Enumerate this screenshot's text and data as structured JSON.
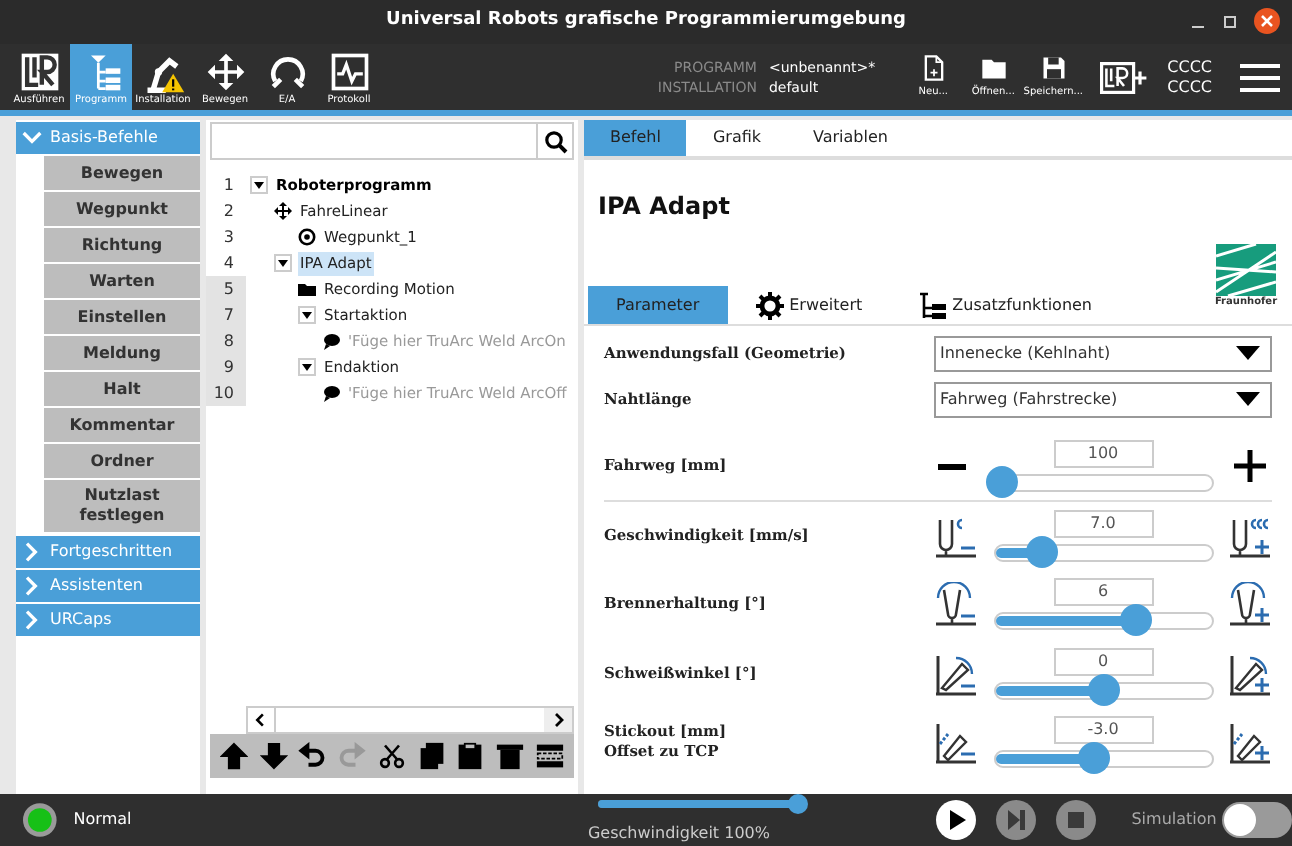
{
  "window": {
    "title": "Universal Robots grafische Programmierumgebung"
  },
  "toolbar": {
    "tabs": [
      {
        "label": "Ausführen",
        "kind": "run",
        "selected": false,
        "warning": false
      },
      {
        "label": "Programm",
        "kind": "program",
        "selected": true,
        "warning": false
      },
      {
        "label": "Installation",
        "kind": "installation",
        "selected": false,
        "warning": true
      },
      {
        "label": "Bewegen",
        "kind": "move",
        "selected": false,
        "warning": false
      },
      {
        "label": "E/A",
        "kind": "io",
        "selected": false,
        "warning": false
      },
      {
        "label": "Protokoll",
        "kind": "log",
        "selected": false,
        "warning": false
      }
    ],
    "program_label": "PROGRAMM",
    "program_value": "<unbenannt>*",
    "installation_label": "INSTALLATION",
    "installation_value": "default",
    "file_buttons": [
      {
        "kind": "new",
        "label": "Neu..."
      },
      {
        "kind": "open",
        "label": "Öffnen..."
      },
      {
        "kind": "save",
        "label": "Speichern..."
      }
    ],
    "status_lines": [
      "CCCC",
      "CCCC"
    ]
  },
  "sidebar": {
    "groups": [
      {
        "label": "Basis-Befehle",
        "expanded": true,
        "items": [
          "Bewegen",
          "Wegpunkt",
          "Richtung",
          "Warten",
          "Einstellen",
          "Meldung",
          "Halt",
          "Kommentar",
          "Ordner",
          "Nutzlast festlegen"
        ]
      },
      {
        "label": "Fortgeschritten",
        "expanded": false
      },
      {
        "label": "Assistenten",
        "expanded": false
      },
      {
        "label": "URCaps",
        "expanded": false
      }
    ]
  },
  "program_tree": {
    "nodes": [
      {
        "line": "1",
        "label": "Roboterprogramm",
        "kind": "program",
        "selected": false,
        "children": [
          {
            "line": "2",
            "label": "FahreLinear",
            "kind": "move",
            "selected": false,
            "children": [
              {
                "line": "3",
                "label": "Wegpunkt_1",
                "kind": "waypoint",
                "selected": false
              }
            ]
          },
          {
            "line": "4",
            "label": "IPA Adapt",
            "kind": "group",
            "selected": true,
            "children": [
              {
                "line": "5",
                "label": "Recording Motion",
                "kind": "folder",
                "selected": false
              },
              {
                "line": "7",
                "label": "Startaktion",
                "kind": "group",
                "selected": false,
                "children": [
                  {
                    "line": "8",
                    "label": "'Füge hier TruArc Weld ArcOn",
                    "kind": "comment",
                    "selected": false
                  }
                ]
              },
              {
                "line": "9",
                "label": "Endaktion",
                "kind": "group",
                "selected": false,
                "children": [
                  {
                    "line": "10",
                    "label": "'Füge hier TruArc Weld ArcOff",
                    "kind": "comment",
                    "selected": false
                  }
                ]
              }
            ]
          }
        ]
      }
    ],
    "tools": [
      {
        "kind": "up",
        "disabled": false
      },
      {
        "kind": "down",
        "disabled": false
      },
      {
        "kind": "undo",
        "disabled": false
      },
      {
        "kind": "redo",
        "disabled": true
      },
      {
        "kind": "cut",
        "disabled": false
      },
      {
        "kind": "copy",
        "disabled": false
      },
      {
        "kind": "paste",
        "disabled": false
      },
      {
        "kind": "delete",
        "disabled": false
      },
      {
        "kind": "suppress",
        "disabled": false
      }
    ]
  },
  "command_panel": {
    "tabs": [
      {
        "label": "Befehl",
        "selected": true
      },
      {
        "label": "Grafik",
        "selected": false
      },
      {
        "label": "Variablen",
        "selected": false
      }
    ],
    "title": "IPA Adapt",
    "logo_text": "Fraunhofer",
    "subtabs": [
      {
        "label": "Parameter",
        "kind": "plain",
        "selected": true
      },
      {
        "label": "Erweitert",
        "kind": "gear",
        "selected": false
      },
      {
        "label": "Zusatzfunktionen",
        "kind": "tree",
        "selected": false
      }
    ],
    "rows": [
      {
        "kind": "dropdown",
        "label": "Anwendungsfall (Geometrie)",
        "value": "Innenecke (Kehlnaht)"
      },
      {
        "kind": "dropdown",
        "label": "Nahtlänge",
        "value": "Fahrweg (Fahrstrecke)"
      },
      {
        "kind": "slider",
        "label": "Fahrweg [mm]",
        "value": "100",
        "level": 0.03
      },
      {
        "kind": "slider",
        "label": "Geschwindigkeit [mm/s]",
        "value": "7.0",
        "level": 0.22
      },
      {
        "kind": "slider",
        "label": "Brennerhaltung [°]",
        "value": "6",
        "level": 0.65
      },
      {
        "kind": "slider",
        "label": "Schweißwinkel [°]",
        "value": "0",
        "level": 0.5
      },
      {
        "kind": "slider",
        "label": "Stickout [mm]\nOffset zu TCP",
        "value": "-3.0",
        "level": 0.46
      }
    ]
  },
  "footer": {
    "status": "Normal",
    "speed": {
      "label": "Geschwindigkeit 100%",
      "level": 1.0
    },
    "buttons": [
      {
        "kind": "play",
        "disabled": false
      },
      {
        "kind": "step",
        "disabled": true
      },
      {
        "kind": "stop",
        "disabled": true
      }
    ],
    "simulation": {
      "label": "Simulation",
      "on": false
    }
  }
}
